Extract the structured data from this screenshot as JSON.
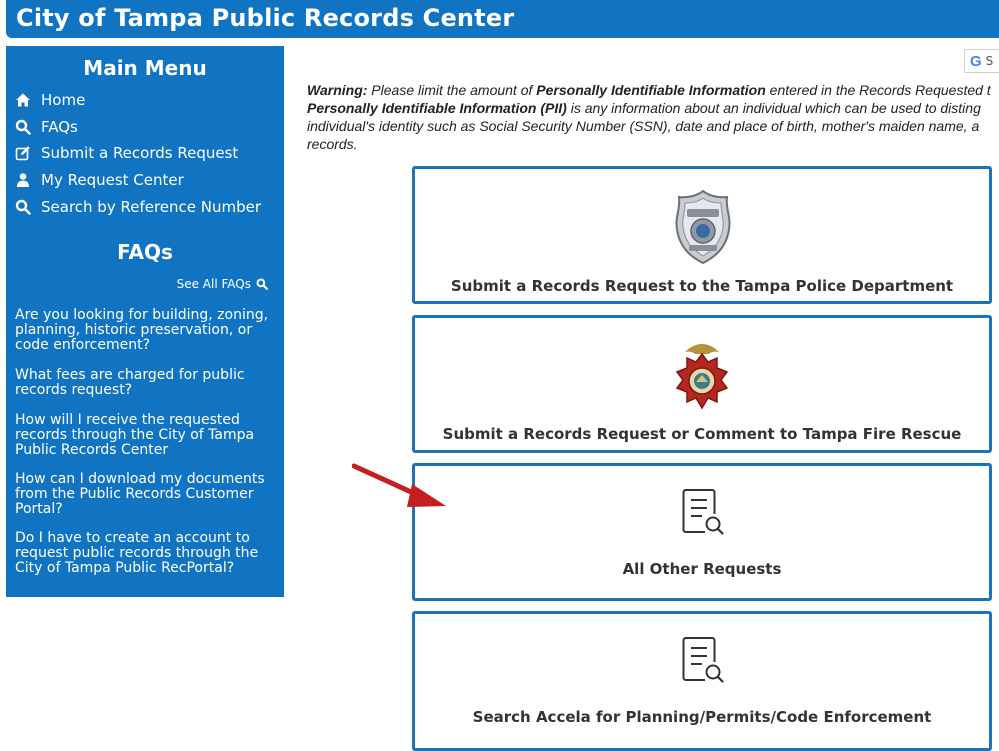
{
  "header": {
    "title": "City of Tampa Public Records Center"
  },
  "sidebar": {
    "menu_title": "Main Menu",
    "menu_items": [
      {
        "label": "Home",
        "icon": "home-icon"
      },
      {
        "label": "FAQs",
        "icon": "search-icon"
      },
      {
        "label": "Submit a Records Request",
        "icon": "edit-icon"
      },
      {
        "label": "My Request Center",
        "icon": "user-icon"
      },
      {
        "label": "Search by Reference Number",
        "icon": "search-icon"
      }
    ],
    "faq_title": "FAQs",
    "see_all": "See All FAQs",
    "faqs": [
      "Are you looking for building, zoning, planning, historic preservation, or code enforcement?",
      "What fees are charged for public records request?",
      "How will I receive the requested records through the City of Tampa Public Records Center",
      "How can I download my documents from the Public Records Customer Portal?",
      "Do I have to create an account to request public records through the City of Tampa Public RecPortal?"
    ]
  },
  "google": {
    "letter": "G",
    "label": "S"
  },
  "warning": {
    "lead": "Warning:",
    "text1": " Please limit the amount of ",
    "bold1": "Personally Identifiable Information",
    "text2": " entered in the Records Requested t",
    "bold2": "Personally Identifiable Information (PII)",
    "text3": " is any information about an individual which can be used to disting",
    "line3": "individual's identity such as Social Security Number (SSN), date and place of birth, mother's maiden name, a",
    "line4": "records."
  },
  "cards": [
    {
      "label": "Submit a Records Request to the Tampa Police Department",
      "icon": "police-badge-icon"
    },
    {
      "label": "Submit a Records Request or Comment to Tampa Fire Rescue",
      "icon": "fire-rescue-badge-icon"
    },
    {
      "label": "All Other Requests",
      "icon": "document-search-icon"
    },
    {
      "label": "Search Accela for Planning/Permits/Code Enforcement",
      "icon": "document-search-icon"
    }
  ],
  "colors": {
    "brand_blue": "#1074c3",
    "card_border": "#1d73b8",
    "arrow_red": "#c41e1e"
  }
}
